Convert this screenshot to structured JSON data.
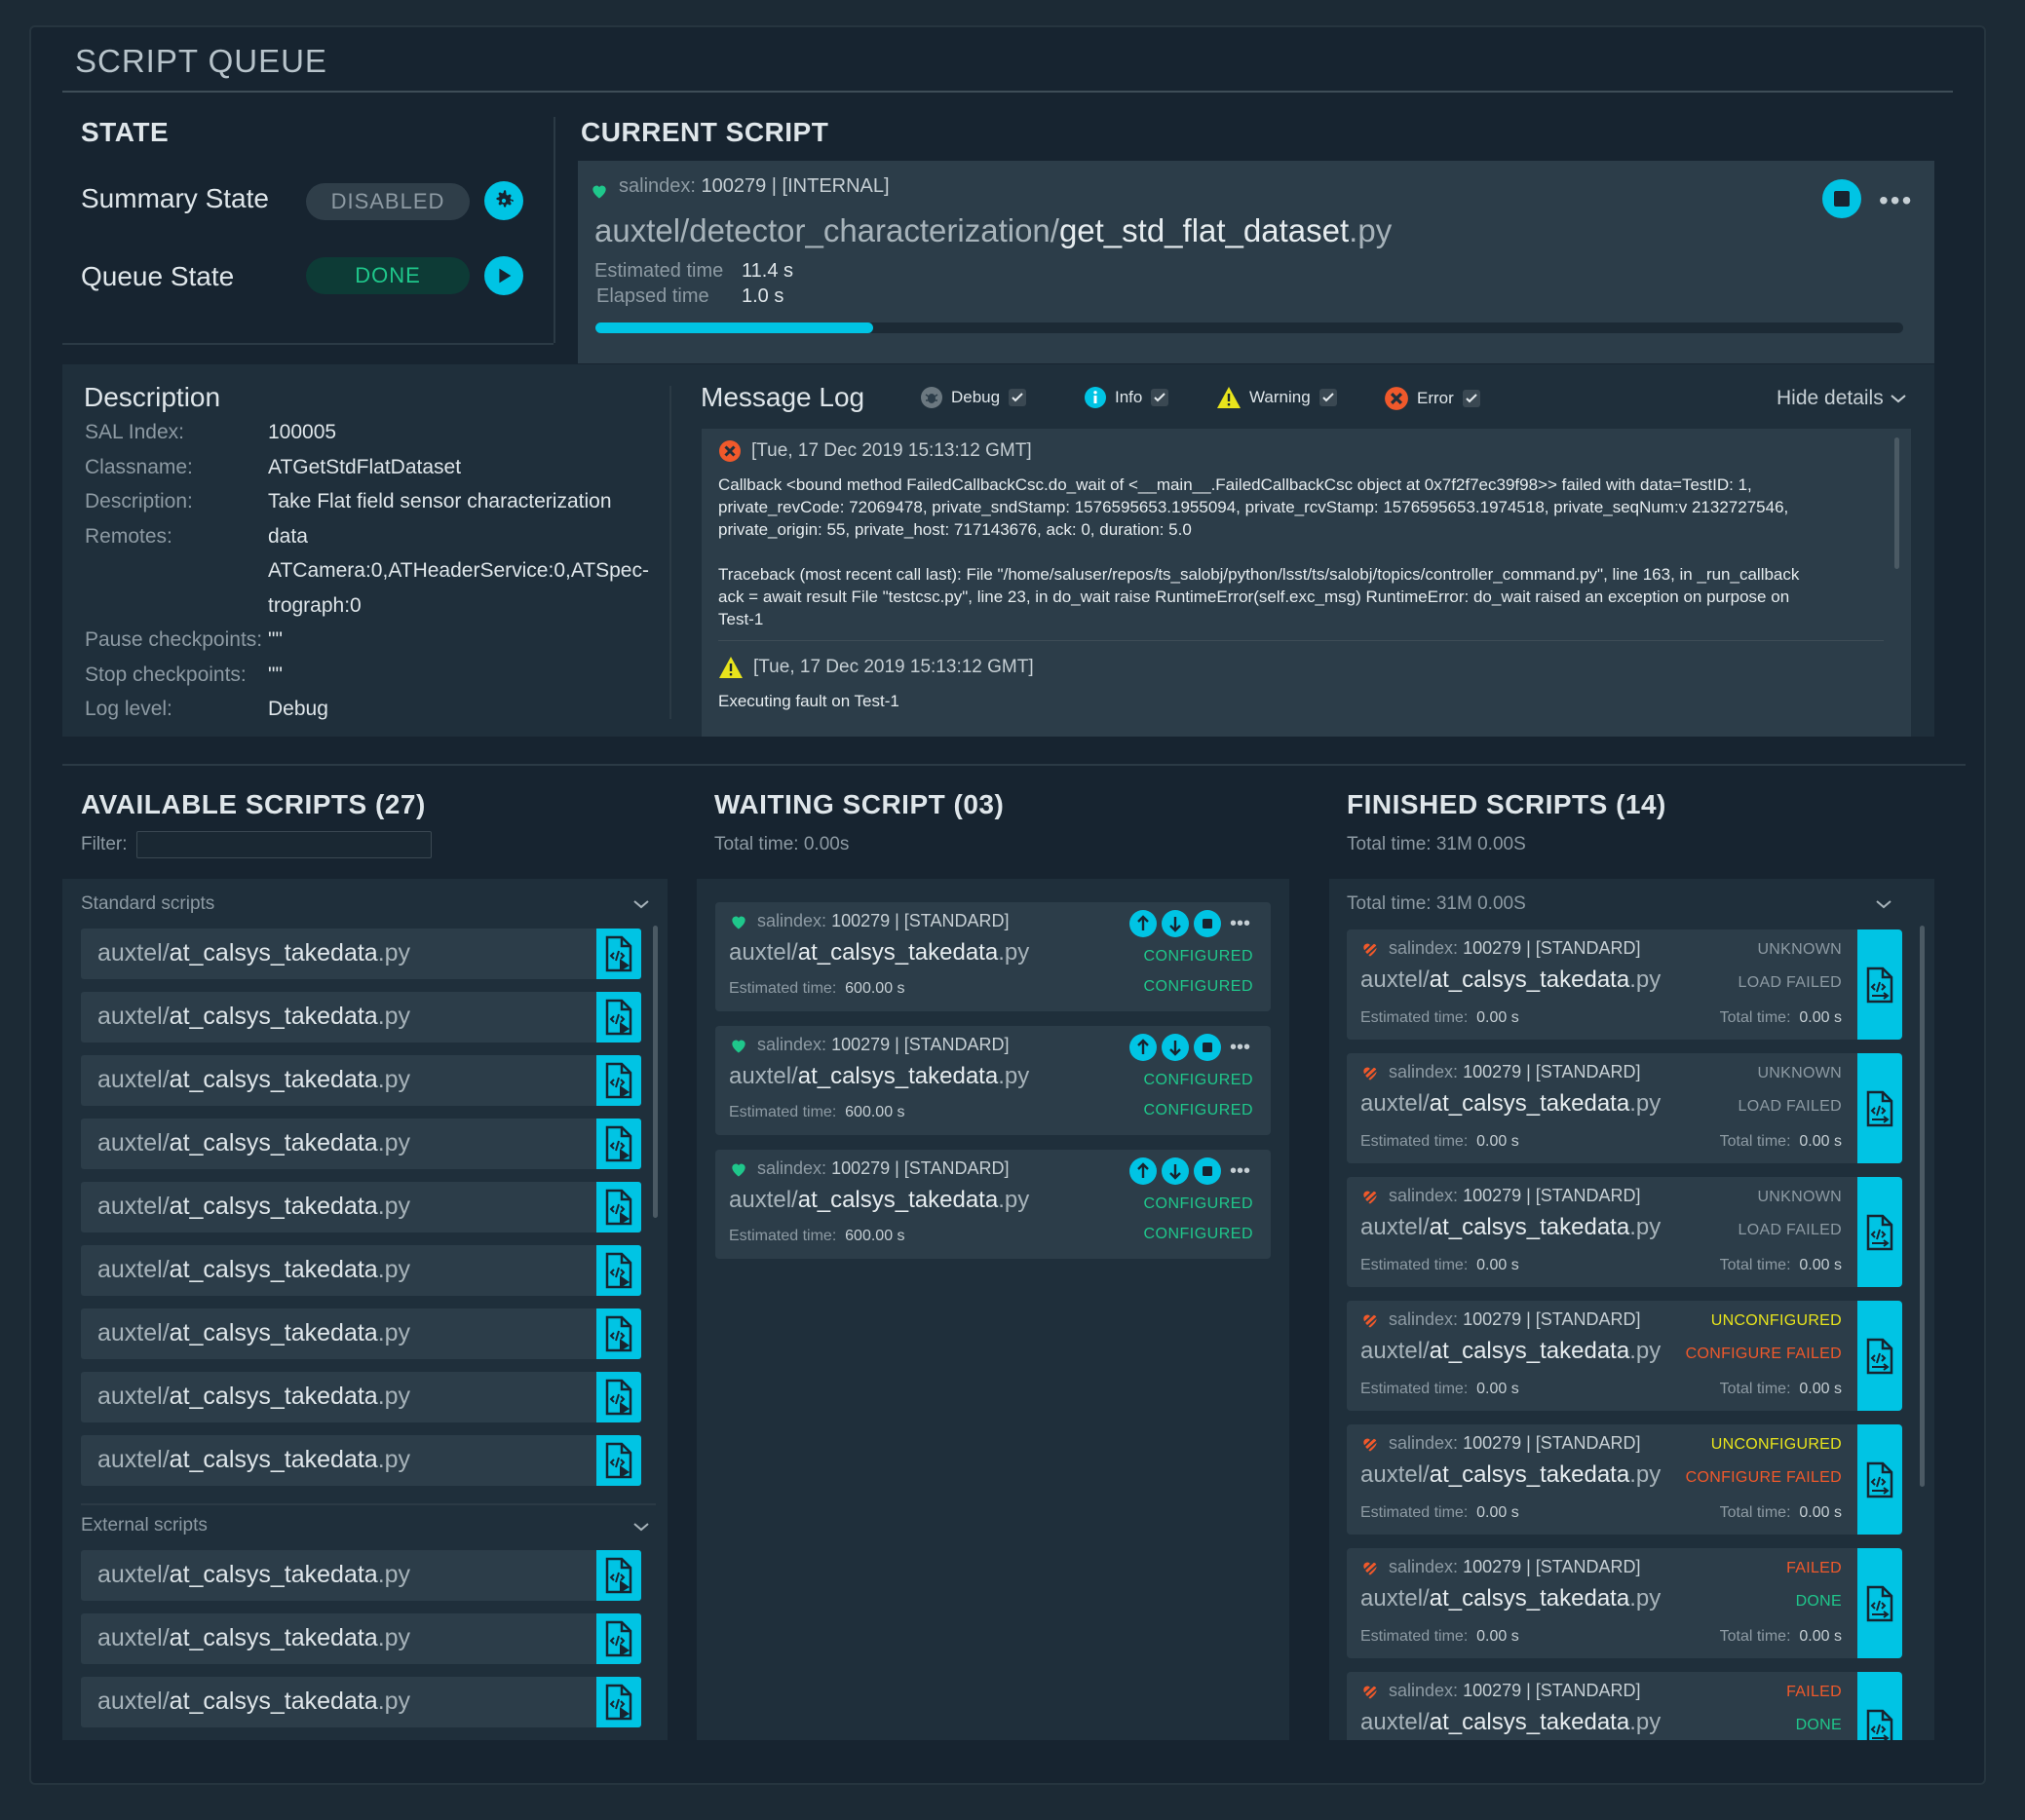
{
  "title": "SCRIPT QUEUE",
  "state": {
    "heading": "STATE",
    "summary_label": "Summary State",
    "summary_value": "DISABLED",
    "queue_label": "Queue State",
    "queue_value": "DONE"
  },
  "current": {
    "heading": "CURRENT SCRIPT",
    "salindex_label": "salindex:",
    "salindex_value": "100279 | [INTERNAL]",
    "path_prefix": "auxtel/detector_characterization/",
    "path_name": "get_std_flat_dataset",
    "path_ext": ".py",
    "est_label": "Estimated time",
    "est_value": "11.4 s",
    "elapsed_label": "Elapsed time",
    "elapsed_value": "1.0 s",
    "progress": 0.212
  },
  "description": {
    "heading": "Description",
    "rows": [
      {
        "key": "SAL Index:",
        "val": "100005"
      },
      {
        "key": "Classname:",
        "val": "ATGetStdFlatDataset"
      },
      {
        "key": "Description:",
        "val": "Take Flat field sensor characterization"
      },
      {
        "key": "Remotes:",
        "val": "data"
      },
      {
        "key": "",
        "val": "ATCamera:0,ATHeaderService:0,ATSpec-"
      },
      {
        "key": "",
        "val": "trograph:0"
      },
      {
        "key": "Pause checkpoints:",
        "val": "\"\""
      },
      {
        "key": "Stop checkpoints:",
        "val": "\"\""
      },
      {
        "key": "Log level:",
        "val": "Debug"
      }
    ]
  },
  "log": {
    "heading": "Message Log",
    "filters": [
      "Debug",
      "Info",
      "Warning",
      "Error"
    ],
    "hide_label": "Hide details",
    "entries": [
      {
        "level": "error",
        "timestamp": "[Tue, 17 Dec 2019 15:13:12 GMT]",
        "lines": [
          "Callback <bound method FailedCallbackCsc.do_wait of <__main__.FailedCallbackCsc object at 0x7f2f7ec39f98>> failed with data=TestID: 1,",
          "private_revCode: 72069478, private_sndStamp: 1576595653.1955094, private_rcvStamp: 1576595653.1974518, private_seqNum:v 2132727546,",
          "private_origin: 55, private_host: 717143676, ack: 0, duration: 5.0",
          "",
          "Traceback (most recent call last): File \"/home/saluser/repos/ts_salobj/python/lsst/ts/salobj/topics/controller_command.py\", line 163, in _run_callback",
          "ack = await result File \"testcsc.py\", line 23, in do_wait raise RuntimeError(self.exc_msg) RuntimeError: do_wait raised an exception on purpose on",
          "Test-1"
        ]
      },
      {
        "level": "warning",
        "timestamp": "[Tue, 17 Dec 2019 15:13:12 GMT]",
        "lines": [
          "Executing fault on Test-1"
        ]
      }
    ]
  },
  "available": {
    "heading": "AVAILABLE SCRIPTS (27)",
    "filter_label": "Filter:",
    "standard_label": "Standard scripts",
    "external_label": "External scripts",
    "item_prefix": "auxtel/",
    "item_name": "at_calsys_takedata",
    "item_ext": ".py",
    "standard_count": 9,
    "external_count": 3
  },
  "waiting": {
    "heading": "WAITING SCRIPT (03)",
    "total": "Total time: 0.00s",
    "cards": [
      {
        "salindex": "100279 | [STANDARD]",
        "prefix": "auxtel/",
        "name": "at_calsys_takedata",
        "ext": ".py",
        "status1": "CONFIGURED",
        "status2": "CONFIGURED",
        "est_label": "Estimated time:",
        "est": "600.00 s"
      },
      {
        "salindex": "100279 | [STANDARD]",
        "prefix": "auxtel/",
        "name": "at_calsys_takedata",
        "ext": ".py",
        "status1": "CONFIGURED",
        "status2": "CONFIGURED",
        "est_label": "Estimated time:",
        "est": "600.00 s"
      },
      {
        "salindex": "100279 | [STANDARD]",
        "prefix": "auxtel/",
        "name": "at_calsys_takedata",
        "ext": ".py",
        "status1": "CONFIGURED",
        "status2": "CONFIGURED",
        "est_label": "Estimated time:",
        "est": "600.00 s"
      }
    ]
  },
  "finished": {
    "heading": "FINISHED SCRIPTS (14)",
    "total": "Total time: 31M 0.00S",
    "inner_total": "Total time: 31M 0.00S",
    "cards": [
      {
        "salindex": "100279 | [STANDARD]",
        "prefix": "auxtel/",
        "name": "at_calsys_takedata",
        "ext": ".py",
        "status1": "UNKNOWN",
        "s1": "m",
        "status2": "LOAD FAILED",
        "s2": "m",
        "est": "0.00 s",
        "total": "0.00 s"
      },
      {
        "salindex": "100279 | [STANDARD]",
        "prefix": "auxtel/",
        "name": "at_calsys_takedata",
        "ext": ".py",
        "status1": "UNKNOWN",
        "s1": "m",
        "status2": "LOAD FAILED",
        "s2": "m",
        "est": "0.00 s",
        "total": "0.00 s"
      },
      {
        "salindex": "100279 | [STANDARD]",
        "prefix": "auxtel/",
        "name": "at_calsys_takedata",
        "ext": ".py",
        "status1": "UNKNOWN",
        "s1": "m",
        "status2": "LOAD FAILED",
        "s2": "m",
        "est": "0.00 s",
        "total": "0.00 s"
      },
      {
        "salindex": "100279 | [STANDARD]",
        "prefix": "auxtel/",
        "name": "at_calsys_takedata",
        "ext": ".py",
        "status1": "UNCONFIGURED",
        "s1": "y",
        "status2": "CONFIGURE FAILED",
        "s2": "r",
        "est": "0.00 s",
        "total": "0.00 s"
      },
      {
        "salindex": "100279 | [STANDARD]",
        "prefix": "auxtel/",
        "name": "at_calsys_takedata",
        "ext": ".py",
        "status1": "UNCONFIGURED",
        "s1": "y",
        "status2": "CONFIGURE FAILED",
        "s2": "r",
        "est": "0.00 s",
        "total": "0.00 s"
      },
      {
        "salindex": "100279 | [STANDARD]",
        "prefix": "auxtel/",
        "name": "at_calsys_takedata",
        "ext": ".py",
        "status1": "FAILED",
        "s1": "r",
        "status2": "DONE",
        "s2": "g",
        "est": "0.00 s",
        "total": "0.00 s"
      },
      {
        "salindex": "100279 | [STANDARD]",
        "prefix": "auxtel/",
        "name": "at_calsys_takedata",
        "ext": ".py",
        "status1": "FAILED",
        "s1": "r",
        "status2": "DONE",
        "s2": "g",
        "est": "",
        "total": ""
      }
    ],
    "est_label": "Estimated time:",
    "total_label": "Total time:"
  },
  "salindex_label": "salindex:",
  "colors": {
    "accent": "#00c4e4",
    "ok": "#1fc78b",
    "warn": "#e8e41c",
    "error": "#f0592b"
  }
}
